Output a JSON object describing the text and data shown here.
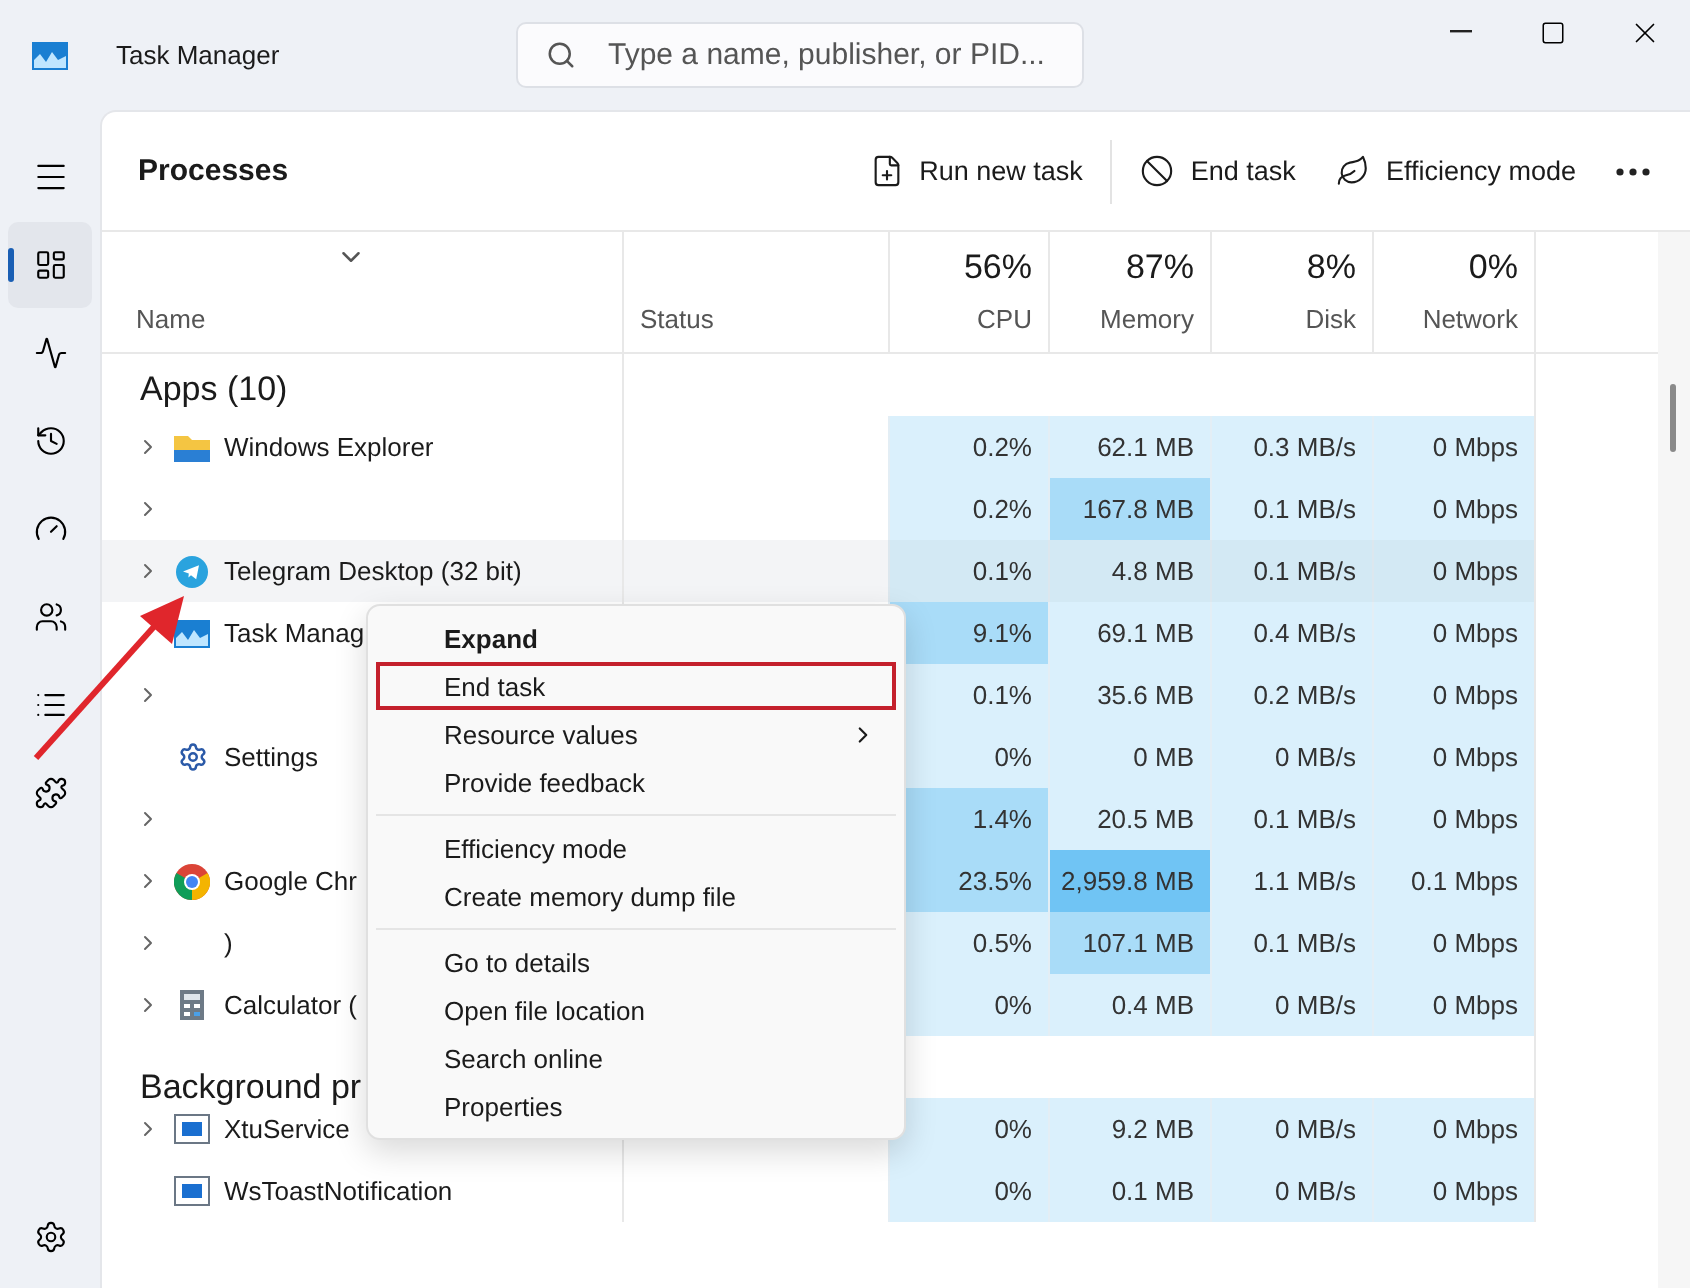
{
  "window": {
    "title": "Task Manager"
  },
  "search": {
    "placeholder": "Type a name, publisher, or PID..."
  },
  "sidebar": {
    "items": [
      {
        "selected": true
      },
      {
        "selected": false
      },
      {
        "selected": false
      },
      {
        "selected": false
      },
      {
        "selected": false
      },
      {
        "selected": false
      },
      {
        "selected": false
      }
    ]
  },
  "page": {
    "title": "Processes",
    "actions": [
      {
        "label": "Run new task"
      },
      {
        "label": "End task"
      },
      {
        "label": "Efficiency mode"
      }
    ]
  },
  "table": {
    "columns": [
      {
        "label": "Name"
      },
      {
        "label": "Status"
      },
      {
        "percent": "56%",
        "label": "CPU"
      },
      {
        "percent": "87%",
        "label": "Memory"
      },
      {
        "percent": "8%",
        "label": "Disk"
      },
      {
        "percent": "0%",
        "label": "Network"
      }
    ],
    "groups": [
      {
        "title": "Apps (10)",
        "rows": [
          {
            "name": "Windows Explorer",
            "kind": "folder",
            "expandable": true,
            "hovered": false,
            "cells": [
              {
                "text": "0.2%",
                "color": "#daf0fc"
              },
              {
                "text": "62.1 MB",
                "color": "#daf0fc"
              },
              {
                "text": "0.3 MB/s",
                "color": "#daf0fc"
              },
              {
                "text": "0 Mbps",
                "color": "#daf0fc"
              }
            ]
          },
          {
            "name": "",
            "kind": "none",
            "expandable": true,
            "hovered": false,
            "cells": [
              {
                "text": "0.2%",
                "color": "#daf0fc"
              },
              {
                "text": "167.8 MB",
                "color": "#a9dcf8"
              },
              {
                "text": "0.1 MB/s",
                "color": "#daf0fc"
              },
              {
                "text": "0 Mbps",
                "color": "#daf0fc"
              }
            ]
          },
          {
            "name": "Telegram Desktop (32 bit)",
            "kind": "telegram",
            "expandable": true,
            "hovered": true,
            "cells": [
              {
                "text": "0.1%",
                "color": "#daf0fc"
              },
              {
                "text": "4.8 MB",
                "color": "#daf0fc"
              },
              {
                "text": "0.1 MB/s",
                "color": "#daf0fc"
              },
              {
                "text": "0 Mbps",
                "color": "#daf0fc"
              }
            ]
          },
          {
            "name": "Task Manag",
            "kind": "taskmanager",
            "expandable": false,
            "hovered": false,
            "cells": [
              {
                "text": "9.1%",
                "color": "#a9dcf8"
              },
              {
                "text": "69.1 MB",
                "color": "#daf0fc"
              },
              {
                "text": "0.4 MB/s",
                "color": "#daf0fc"
              },
              {
                "text": "0 Mbps",
                "color": "#daf0fc"
              }
            ]
          },
          {
            "name": "",
            "kind": "none",
            "expandable": true,
            "hovered": false,
            "cells": [
              {
                "text": "0.1%",
                "color": "#daf0fc"
              },
              {
                "text": "35.6 MB",
                "color": "#daf0fc"
              },
              {
                "text": "0.2 MB/s",
                "color": "#daf0fc"
              },
              {
                "text": "0 Mbps",
                "color": "#daf0fc"
              }
            ]
          },
          {
            "name": "Settings",
            "kind": "gear",
            "expandable": false,
            "hovered": false,
            "cells": [
              {
                "text": "0%",
                "color": "#daf0fc"
              },
              {
                "text": "0 MB",
                "color": "#daf0fc"
              },
              {
                "text": "0 MB/s",
                "color": "#daf0fc"
              },
              {
                "text": "0 Mbps",
                "color": "#daf0fc"
              }
            ]
          },
          {
            "name": "",
            "kind": "none",
            "expandable": true,
            "hovered": false,
            "cells": [
              {
                "text": "1.4%",
                "color": "#a9dcf8"
              },
              {
                "text": "20.5 MB",
                "color": "#daf0fc"
              },
              {
                "text": "0.1 MB/s",
                "color": "#daf0fc"
              },
              {
                "text": "0 Mbps",
                "color": "#daf0fc"
              }
            ]
          },
          {
            "name": "Google Chr",
            "kind": "chrome",
            "expandable": true,
            "hovered": false,
            "cells": [
              {
                "text": "23.5%",
                "color": "#a9dcf8"
              },
              {
                "text": "2,959.8 MB",
                "color": "#70c4f4"
              },
              {
                "text": "1.1 MB/s",
                "color": "#daf0fc"
              },
              {
                "text": "0.1 Mbps",
                "color": "#daf0fc"
              }
            ]
          },
          {
            "name": ")",
            "kind": "none",
            "expandable": true,
            "hovered": false,
            "cells": [
              {
                "text": "0.5%",
                "color": "#daf0fc"
              },
              {
                "text": "107.1 MB",
                "color": "#a9dcf8"
              },
              {
                "text": "0.1 MB/s",
                "color": "#daf0fc"
              },
              {
                "text": "0 Mbps",
                "color": "#daf0fc"
              }
            ]
          },
          {
            "name": "Calculator (",
            "kind": "calculator",
            "expandable": true,
            "hovered": false,
            "cells": [
              {
                "text": "0%",
                "color": "#daf0fc"
              },
              {
                "text": "0.4 MB",
                "color": "#daf0fc"
              },
              {
                "text": "0 MB/s",
                "color": "#daf0fc"
              },
              {
                "text": "0 Mbps",
                "color": "#daf0fc"
              }
            ]
          }
        ]
      },
      {
        "title": "Background pr",
        "rows": [
          {
            "name": "XtuService",
            "kind": "service",
            "expandable": true,
            "hovered": false,
            "cells": [
              {
                "text": "0%",
                "color": "#daf0fc"
              },
              {
                "text": "9.2 MB",
                "color": "#daf0fc"
              },
              {
                "text": "0 MB/s",
                "color": "#daf0fc"
              },
              {
                "text": "0 Mbps",
                "color": "#daf0fc"
              }
            ]
          },
          {
            "name": "WsToastNotification",
            "kind": "service",
            "expandable": false,
            "hovered": false,
            "cells": [
              {
                "text": "0%",
                "color": "#daf0fc"
              },
              {
                "text": "0.1 MB",
                "color": "#daf0fc"
              },
              {
                "text": "0 MB/s",
                "color": "#daf0fc"
              },
              {
                "text": "0 Mbps",
                "color": "#daf0fc"
              }
            ]
          }
        ]
      }
    ]
  },
  "context_menu": {
    "sections": [
      [
        {
          "label": "Expand",
          "bold": true,
          "submenu": false,
          "outlined": false
        },
        {
          "label": "End task",
          "bold": false,
          "submenu": false,
          "outlined": true
        },
        {
          "label": "Resource values",
          "bold": false,
          "submenu": true,
          "outlined": false
        },
        {
          "label": "Provide feedback",
          "bold": false,
          "submenu": false,
          "outlined": false
        }
      ],
      [
        {
          "label": "Efficiency mode",
          "bold": false,
          "submenu": false,
          "outlined": false
        },
        {
          "label": "Create memory dump file",
          "bold": false,
          "submenu": false,
          "outlined": false
        }
      ],
      [
        {
          "label": "Go to details",
          "bold": false,
          "submenu": false,
          "outlined": false
        },
        {
          "label": "Open file location",
          "bold": false,
          "submenu": false,
          "outlined": false
        },
        {
          "label": "Search online",
          "bold": false,
          "submenu": false,
          "outlined": false
        },
        {
          "label": "Properties",
          "bold": false,
          "submenu": false,
          "outlined": false
        }
      ]
    ]
  }
}
